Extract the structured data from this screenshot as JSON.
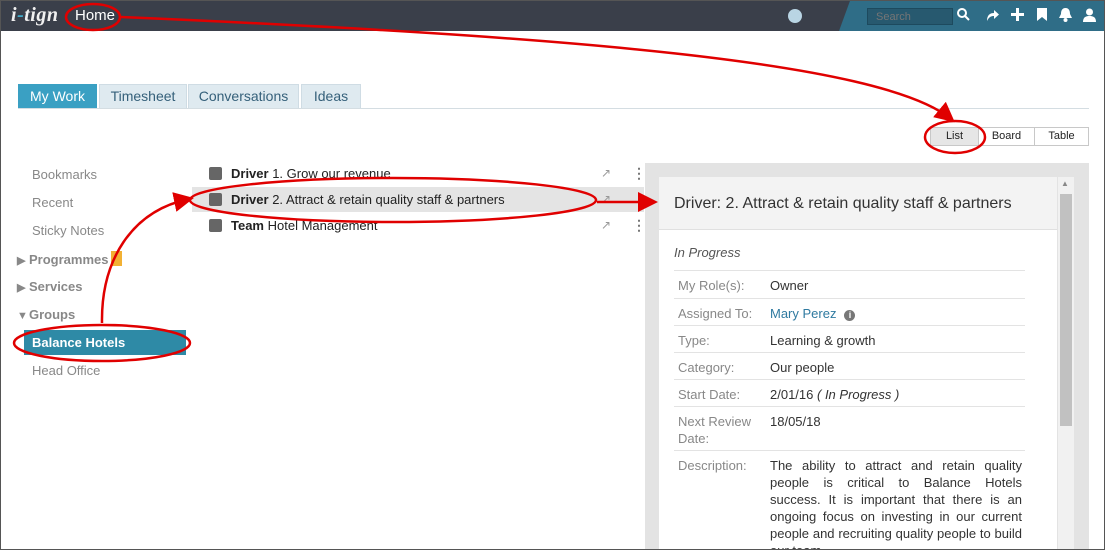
{
  "topbar": {
    "logo_text": "i-tign",
    "home_label": "Home",
    "search_placeholder": "Search",
    "icons": [
      "globe-icon",
      "search-icon",
      "share-icon",
      "plus-icon",
      "bookmark-icon",
      "bell-icon",
      "user-icon"
    ]
  },
  "tabs": [
    "My Work",
    "Timesheet",
    "Conversations",
    "Ideas"
  ],
  "active_tab": "My Work",
  "view_switch": {
    "options": [
      "List",
      "Board",
      "Table"
    ],
    "active": "List"
  },
  "sidebar": {
    "items": [
      "Bookmarks",
      "Recent",
      "Sticky Notes"
    ],
    "groups": [
      "Programmes",
      "Services",
      "Groups"
    ],
    "group_items": [
      "Balance Hotels",
      "Head Office"
    ],
    "active_item": "Balance Hotels"
  },
  "list": [
    {
      "kind": "Driver",
      "text": "1. Grow our revenue"
    },
    {
      "kind": "Driver",
      "text": "2. Attract & retain quality staff & partners"
    },
    {
      "kind": "Team",
      "text": "Hotel Management"
    }
  ],
  "detail": {
    "title": "Driver: 2. Attract & retain quality staff & partners",
    "status": "In Progress",
    "fields": [
      {
        "label": "My Role(s):",
        "value": "Owner"
      },
      {
        "label": "Assigned To:",
        "value": "Mary Perez"
      },
      {
        "label": "Type:",
        "value": "Learning & growth"
      },
      {
        "label": "Category:",
        "value": "Our people"
      },
      {
        "label": "Start Date:",
        "value": "2/01/16",
        "note": "( In Progress )"
      },
      {
        "label": "Next Review Date:",
        "value": "18/05/18"
      },
      {
        "label": "Description:",
        "value": "The ability to attract and retain quality people is critical to Balance Hotels success. It is important that there is an ongoing focus on investing in our current people and recruiting quality people to build our team."
      }
    ]
  },
  "colors": {
    "topbar": "#3a3f4a",
    "accent": "#3aa0c3",
    "sidebar_active": "#2e8aa6",
    "annotation_red": "#e00000",
    "badge": "#f2b134"
  }
}
